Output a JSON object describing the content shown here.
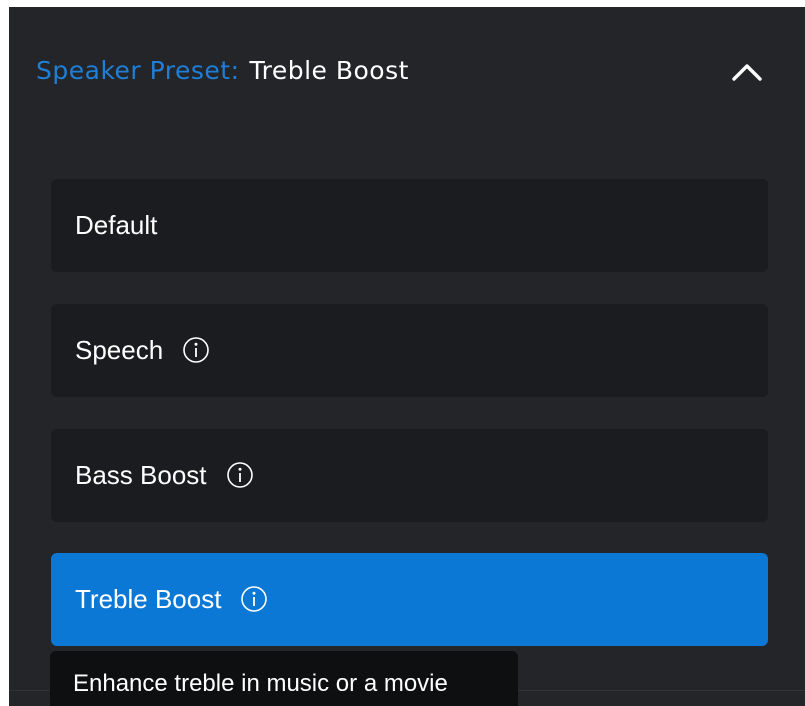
{
  "header": {
    "prefix": "Speaker Preset:",
    "value": "Treble Boost",
    "collapse_icon": "chevron-up-icon"
  },
  "options": [
    {
      "label": "Default",
      "has_info": false,
      "selected": false
    },
    {
      "label": "Speech",
      "has_info": true,
      "selected": false
    },
    {
      "label": "Bass Boost",
      "has_info": true,
      "selected": false
    },
    {
      "label": "Treble Boost",
      "has_info": true,
      "selected": true
    }
  ],
  "tooltip": {
    "text": "Enhance treble in music or a movie"
  },
  "colors": {
    "panel_background": "#232529",
    "option_background": "#1b1c20",
    "accent": "#0a78d4",
    "header_prefix": "#1f7fd6",
    "tooltip_background": "#0e0f11",
    "text": "#ffffff"
  },
  "icons": {
    "info": "info-icon",
    "collapse": "chevron-up-icon"
  }
}
